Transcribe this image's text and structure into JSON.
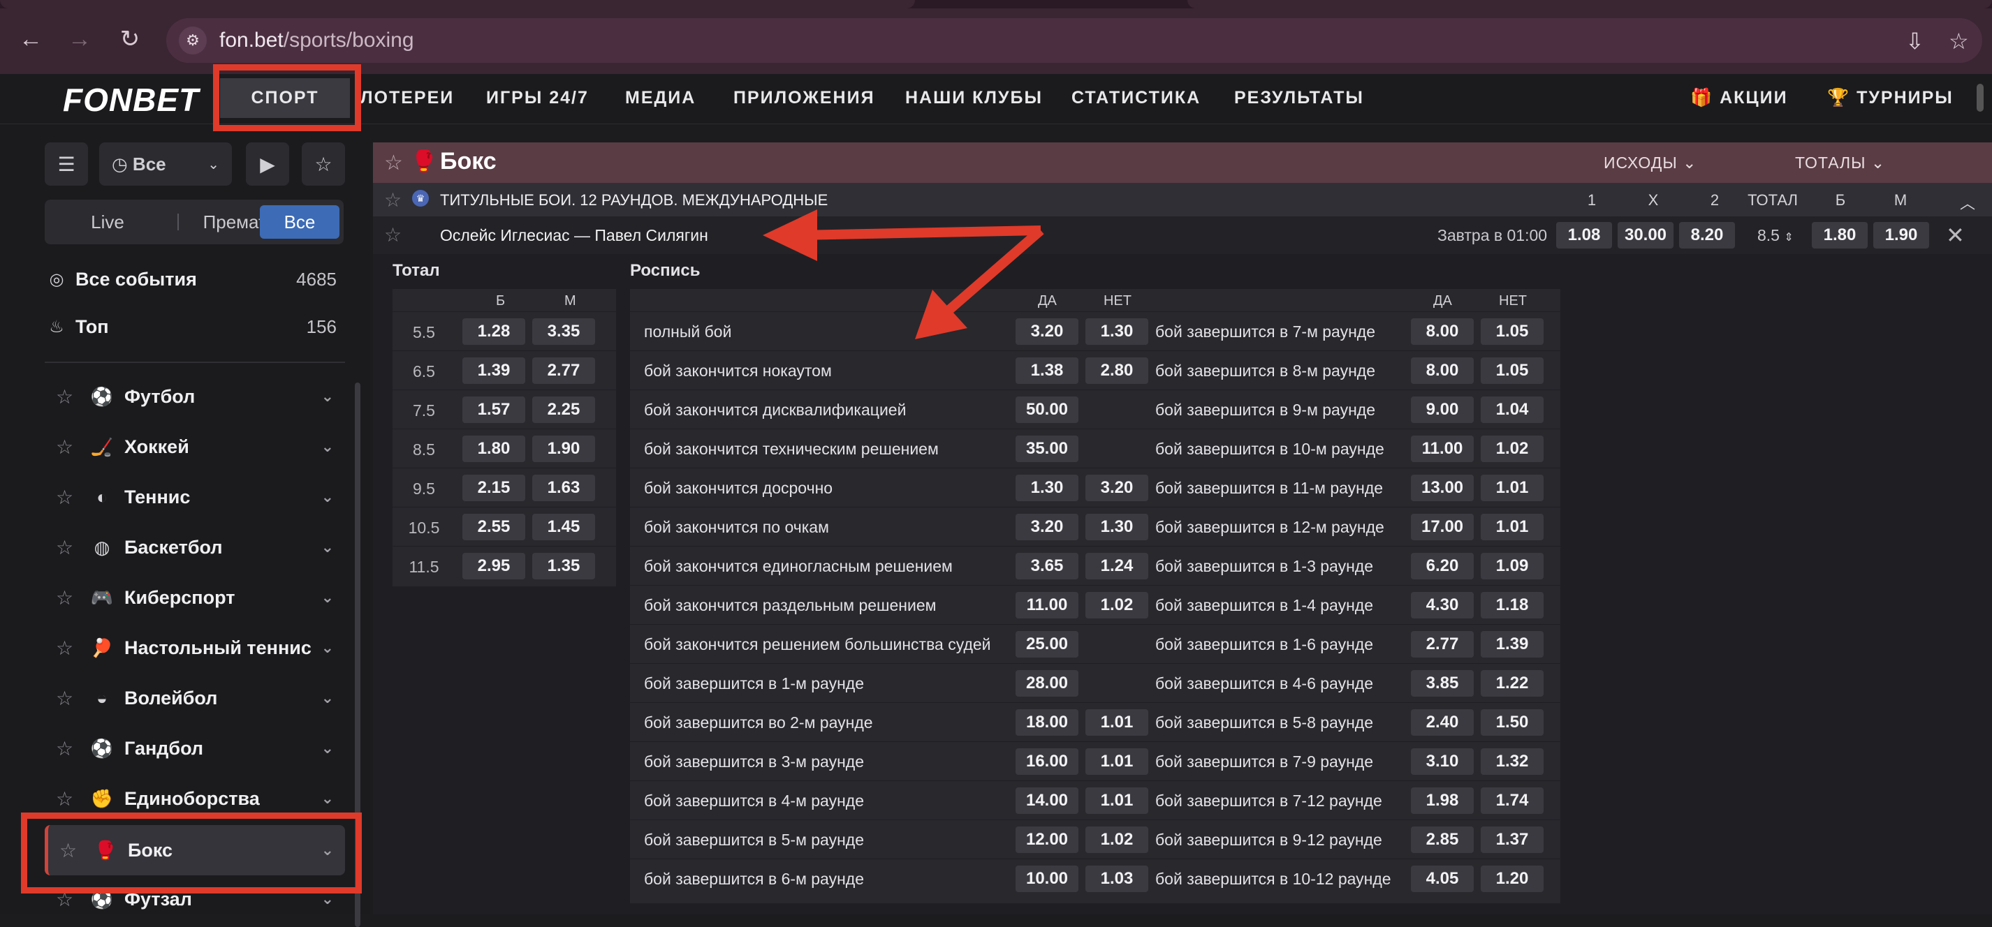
{
  "browser": {
    "url_domain": "fon.bet",
    "url_path": "/sports/boxing",
    "back_icon": "←",
    "forward_icon": "→",
    "reload_icon": "↻",
    "site_info_icon": "⚙",
    "install_icon": "⇩",
    "bookmark_icon": "☆"
  },
  "header": {
    "logo": "FONBET",
    "nav": [
      "СПОРТ",
      "ЛОТЕРЕИ",
      "ИГРЫ 24/7",
      "МЕДИА",
      "ПРИЛОЖЕНИЯ",
      "НАШИ КЛУБЫ",
      "СТАТИСТИКА",
      "РЕЗУЛЬТАТЫ"
    ],
    "promo": "АКЦИИ",
    "tournaments": "ТУРНИРЫ"
  },
  "sidebar": {
    "time_filter": "Все",
    "segments": [
      "Live",
      "Прематч",
      "Все"
    ],
    "all_events": {
      "label": "Все события",
      "count": "4685"
    },
    "top": {
      "label": "Топ",
      "count": "156"
    },
    "sports": [
      "Футбол",
      "Хоккей",
      "Теннис",
      "Баскетбол",
      "Киберспорт",
      "Настольный теннис",
      "Волейбол",
      "Гандбол",
      "Единоборства",
      "Бокс",
      "Футзал"
    ]
  },
  "main": {
    "sport_title": "Бокс",
    "dropdown_outcomes": "ИСХОДЫ",
    "dropdown_totals": "ТОТАЛЫ",
    "league": "ТИТУЛЬНЫЕ БОИ. 12 РАУНДОВ. МЕЖДУНАРОДНЫЕ",
    "col_headers": [
      "1",
      "X",
      "2",
      "ТОТАЛ",
      "Б",
      "М"
    ],
    "event": {
      "name": "Ослейс Иглесиас — Павел Силягин",
      "time": "Завтра в 01:00",
      "odds_1": "1.08",
      "odds_x": "30.00",
      "odds_2": "8.20",
      "total": "8.5",
      "over": "1.80",
      "under": "1.90"
    },
    "totals_panel": {
      "title": "Тотал",
      "col_b": "Б",
      "col_m": "М",
      "rows": [
        [
          "5.5",
          "1.28",
          "3.35"
        ],
        [
          "6.5",
          "1.39",
          "2.77"
        ],
        [
          "7.5",
          "1.57",
          "2.25"
        ],
        [
          "8.5",
          "1.80",
          "1.90"
        ],
        [
          "9.5",
          "2.15",
          "1.63"
        ],
        [
          "10.5",
          "2.55",
          "1.45"
        ],
        [
          "11.5",
          "2.95",
          "1.35"
        ]
      ]
    },
    "raspis_panel": {
      "title": "Роспись",
      "col_yes": "ДА",
      "col_no": "НЕТ",
      "rows": [
        [
          "полный бой",
          "3.20",
          "1.30",
          "бой завершится в 7-м раунде",
          "8.00",
          "1.05"
        ],
        [
          "бой закончится нокаутом",
          "1.38",
          "2.80",
          "бой завершится в 8-м раунде",
          "8.00",
          "1.05"
        ],
        [
          "бой закончится дисквалификацией",
          "50.00",
          "",
          "бой завершится в 9-м раунде",
          "9.00",
          "1.04"
        ],
        [
          "бой закончится техническим решением",
          "35.00",
          "",
          "бой завершится в 10-м раунде",
          "11.00",
          "1.02"
        ],
        [
          "бой закончится досрочно",
          "1.30",
          "3.20",
          "бой завершится в 11-м раунде",
          "13.00",
          "1.01"
        ],
        [
          "бой закончится по очкам",
          "3.20",
          "1.30",
          "бой завершится в 12-м раунде",
          "17.00",
          "1.01"
        ],
        [
          "бой закончится единогласным решением",
          "3.65",
          "1.24",
          "бой завершится в 1-3 раунде",
          "6.20",
          "1.09"
        ],
        [
          "бой закончится раздельным решением",
          "11.00",
          "1.02",
          "бой завершится в 1-4 раунде",
          "4.30",
          "1.18"
        ],
        [
          "бой закончится решением большинства судей",
          "25.00",
          "",
          "бой завершится в 1-6 раунде",
          "2.77",
          "1.39"
        ],
        [
          "бой завершится в 1-м раунде",
          "28.00",
          "",
          "бой завершится в 4-6 раунде",
          "3.85",
          "1.22"
        ],
        [
          "бой завершится во 2-м раунде",
          "18.00",
          "1.01",
          "бой завершится в 5-8 раунде",
          "2.40",
          "1.50"
        ],
        [
          "бой завершится в 3-м раунде",
          "16.00",
          "1.01",
          "бой завершится в 7-9 раунде",
          "3.10",
          "1.32"
        ],
        [
          "бой завершится в 4-м раунде",
          "14.00",
          "1.01",
          "бой завершится в 7-12 раунде",
          "1.98",
          "1.74"
        ],
        [
          "бой завершится в 5-м раунде",
          "12.00",
          "1.02",
          "бой завершится в 9-12 раунде",
          "2.85",
          "1.37"
        ],
        [
          "бой завершится в 6-м раунде",
          "10.00",
          "1.03",
          "бой завершится в 10-12 раунде",
          "4.05",
          "1.20"
        ]
      ]
    }
  },
  "colors": {
    "annotation": "#e03a2a",
    "accent": "#3d6bb5",
    "sport_header": "#5a3c45"
  }
}
